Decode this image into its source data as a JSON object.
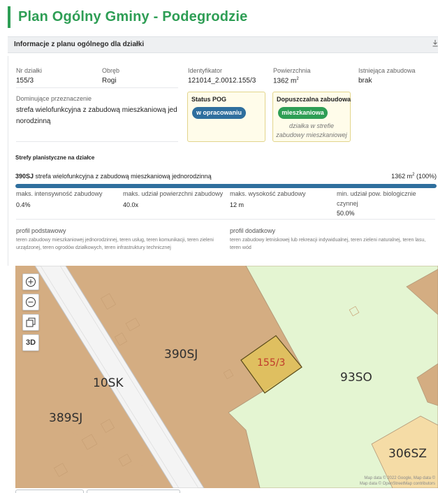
{
  "header": {
    "title": "Plan Ogólny Gminy - Podegrodzie"
  },
  "section": {
    "title": "Informacje z planu ogólnego dla działki",
    "download_icon": "download-icon"
  },
  "parcel": {
    "nr_label": "Nr działki",
    "nr_value": "155/3",
    "obreb_label": "Obręb",
    "obreb_value": "Rogi",
    "id_label": "Identyfikator",
    "id_value": "121014_2.0012.155/3",
    "area_label": "Powierzchnia",
    "area_value": "1362 m",
    "area_unit_sup": "2",
    "existing_label": "Istniejąca zabudowa",
    "existing_value": "brak",
    "dominant_label": "Dominujące przeznaczenie",
    "dominant_value_line1": "strefa wielofunkcyjna z zabudową mieszkaniową jed",
    "dominant_value_line2": "norodzinną"
  },
  "status_pog": {
    "title": "Status POG",
    "badge": "w opracowaniu",
    "badge_color": "#2f6f9e"
  },
  "allowed": {
    "title": "Dopuszczalna zabudowa",
    "badge": "mieszkaniowa",
    "badge_color": "#2e9e55",
    "note_line1": "działka w strefie",
    "note_line2": "zabudowy mieszkaniowej"
  },
  "zones": {
    "title": "Strefy planistyczne na działce",
    "code": "390SJ",
    "description": " strefa wielofunkcyjna z zabudową mieszkaniową jednorodzinną",
    "area_text": "1362 m",
    "area_sup": "2",
    "area_pct": " (100%)",
    "coverage_percent": 100
  },
  "metrics": [
    {
      "label": "maks. intensywność zabudowy",
      "value": "0.4%"
    },
    {
      "label": "maks. udział powierzchni zabudowy",
      "value": "40.0x"
    },
    {
      "label": "maks. wysokość zabudowy",
      "value": "12 m"
    },
    {
      "label": "min. udział pow. biologicznie czynnej",
      "value": "50.0%"
    }
  ],
  "profiles": {
    "basic_label": "profil podstawowy",
    "basic_text": "teren zabudowy mieszkaniowej jednorodzinnej, teren usług, teren komunikacji, teren zieleni urządzonej, teren ogrodów działkowych, teren infrastruktury technicznej",
    "extra_label": "profil dodatkowy",
    "extra_text": "teren zabudowy letniskowej lub rekreacji indywidualnej, teren zieleni naturalnej, teren lasu, teren wód"
  },
  "map": {
    "labels": {
      "z390": "390SJ",
      "z10": "10SK",
      "z389": "389SJ",
      "z93": "93SO",
      "z306": "306SZ",
      "plot": "155/3"
    },
    "controls": {
      "zoom_in": "zoom-in-icon",
      "zoom_out": "zoom-out-icon",
      "layers": "layers-icon",
      "mode_3d": "3D"
    },
    "attribution_line1": "Map data © 2022 Google, Map data ©",
    "attribution_line2": "Map data © OpenStreetMap contributors"
  },
  "colors": {
    "accent": "#2e9e55",
    "zone_sj": "#d4ad82",
    "zone_so": "#e4f5d2",
    "zone_sz": "#f5dca6",
    "plot_fill": "#e1c25a",
    "road": "#f4f4f4"
  }
}
